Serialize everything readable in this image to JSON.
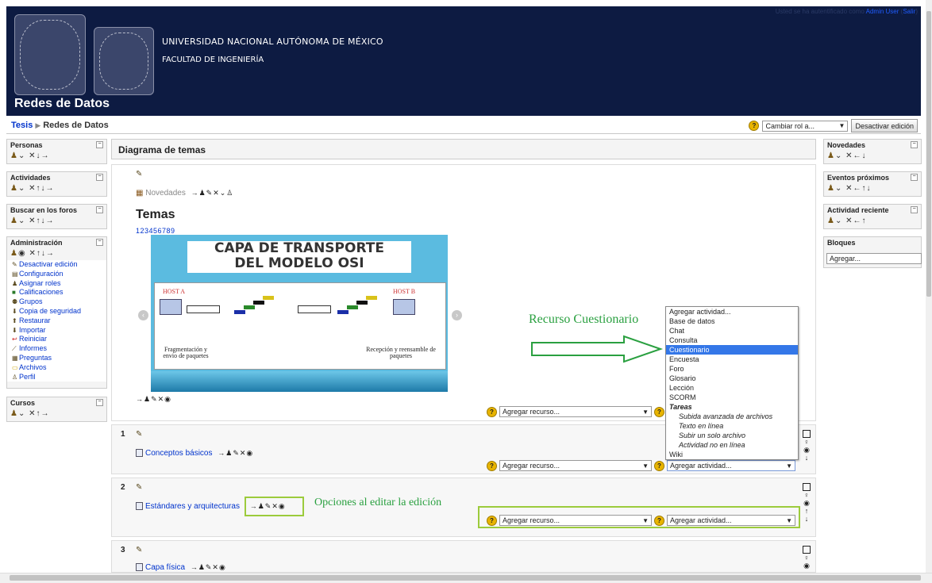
{
  "header": {
    "university": "UNIVERSIDAD NACIONAL AUTÓNOMA DE MÉXICO",
    "faculty": "FACULTAD DE INGENIERÍA",
    "course_title": "Redes de Datos",
    "logo_left_text": "UNIVERSIDAD NACIONAL AUTÓNOMA DE MÉXICO",
    "logo_right_text": "INGENIERÍA",
    "login_text": "Usted se ha autentificado como",
    "login_user": "Admin User",
    "logout": "Salir"
  },
  "breadcrumb": {
    "root": "Tesis",
    "current": "Redes de Datos"
  },
  "role": {
    "select": "Cambiar rol a...",
    "button": "Desactivar edición"
  },
  "left_blocks": {
    "personas": "Personas",
    "actividades": "Actividades",
    "buscar": "Buscar en los foros",
    "admin": "Administración",
    "cursos": "Cursos",
    "admin_items": [
      "Desactivar edición",
      "Configuración",
      "Asignar roles",
      "Calificaciones",
      "Grupos",
      "Copia de seguridad",
      "Restaurar",
      "Importar",
      "Reiniciar",
      "Informes",
      "Preguntas",
      "Archivos",
      "Perfil"
    ]
  },
  "right_blocks": {
    "novedades": "Novedades",
    "eventos": "Eventos próximos",
    "actividad": "Actividad reciente",
    "bloques": "Bloques",
    "agregar": "Agregar..."
  },
  "main": {
    "title": "Diagrama de temas",
    "news": "Novedades",
    "temas": "Temas",
    "pages": "1 2 3 4 5 6 7 8 9",
    "add_resource": "Agregar recurso...",
    "add_activity": "Agregar actividad...",
    "sections": [
      {
        "num": "1",
        "resource": "Conceptos básicos"
      },
      {
        "num": "2",
        "resource": "Estándares y arquitecturas"
      },
      {
        "num": "3",
        "resource": "Capa física"
      }
    ]
  },
  "slide": {
    "title_line1": "CAPA DE TRANSPORTE",
    "title_line2": "DEL MODELO OSI",
    "host_a": "HOST A",
    "host_b": "HOST B",
    "caption_left": "Fragmentación y envio de paquetes",
    "caption_right": "Recepción y reensamble de paquetes"
  },
  "annotations": {
    "cuestionario": "Recurso Cuestionario",
    "opciones": "Opciones al editar la edición"
  },
  "dropdown": {
    "items": [
      "Agregar actividad...",
      "Base de datos",
      "Chat",
      "Consulta",
      "Cuestionario",
      "Encuesta",
      "Foro",
      "Glosario",
      "Lección",
      "SCORM"
    ],
    "group": "Tareas",
    "sub_items": [
      "Subida avanzada de archivos",
      "Texto en línea",
      "Subir un solo archivo",
      "Actividad no en línea"
    ],
    "last": "Wiki",
    "selected": "Cuestionario"
  },
  "colors": {
    "header_bg": "#0d1b42",
    "highlight": "#3477e8",
    "annotation": "#2aa040",
    "box": "#9ccb3c"
  }
}
